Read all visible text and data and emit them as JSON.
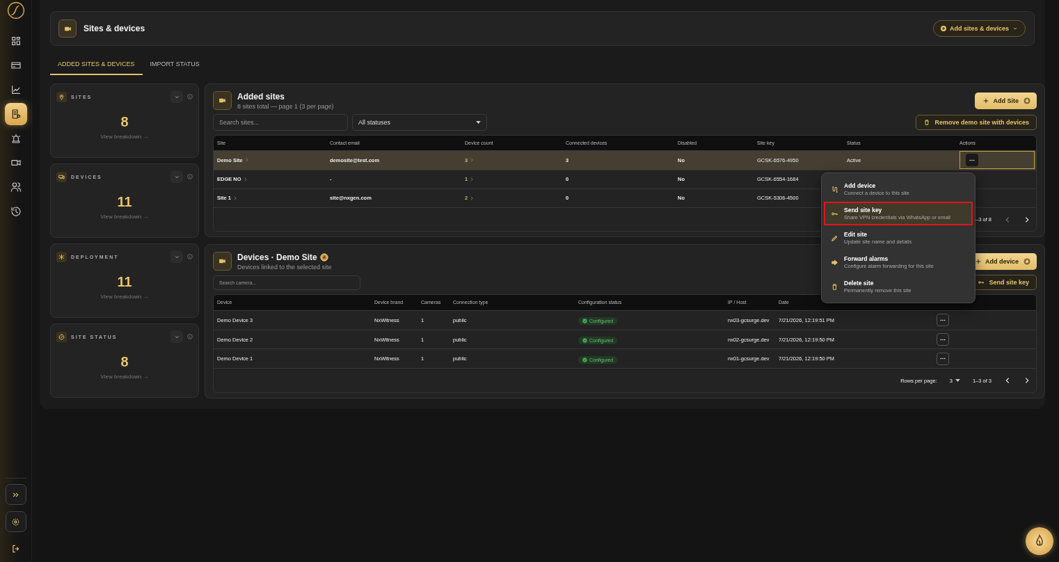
{
  "sidebar": {
    "items": [
      {
        "kind": "dashboard",
        "selected": false
      },
      {
        "kind": "billing",
        "selected": false
      },
      {
        "kind": "analytics",
        "selected": false
      },
      {
        "kind": "sites",
        "selected": true
      },
      {
        "kind": "alarms",
        "selected": false
      },
      {
        "kind": "cameras",
        "selected": false
      },
      {
        "kind": "users",
        "selected": false
      },
      {
        "kind": "history",
        "selected": false
      }
    ]
  },
  "header": {
    "title": "Sites & devices",
    "action": "Add sites & devices"
  },
  "tabs": [
    {
      "label": "ADDED SITES & DEVICES",
      "selected": true
    },
    {
      "label": "IMPORT STATUS",
      "selected": false
    }
  ],
  "stats": [
    {
      "kind": "sites",
      "label": "SITES",
      "value": "8",
      "link": "View breakdown →"
    },
    {
      "kind": "devices",
      "label": "DEVICES",
      "value": "11",
      "link": "View breakdown →"
    },
    {
      "kind": "deployment",
      "label": "DEPLOYMENT",
      "value": "11",
      "link": "View breakdown →"
    },
    {
      "kind": "status",
      "label": "SITE STATUS",
      "value": "8",
      "link": "View breakdown →"
    }
  ],
  "sites_panel": {
    "title": "Added sites",
    "subtitle": "8 sites total — page 1 (3 per page)",
    "add_button": "Add Site",
    "remove_button": "Remove demo site with devices",
    "search": {
      "placeholder": "Search sites..."
    },
    "status_filter": {
      "value": "All statuses"
    },
    "columns": [
      "Site",
      "Contact email",
      "Device count",
      "Connected devices",
      "Disabled",
      "Site key",
      "Status",
      "Actions"
    ],
    "rows": [
      {
        "site": "Demo Site",
        "email": "demosite@test.com",
        "device_count": "3",
        "connected": "3",
        "disabled": "No",
        "site_key": "GCSK-6576-4950",
        "status": "Active",
        "selected": true,
        "menu_open": true
      },
      {
        "site": "EDGE NO",
        "email": "-",
        "device_count": "1",
        "connected": "0",
        "disabled": "No",
        "site_key": "GCSK-6554-1684",
        "selected": false
      },
      {
        "site": "Site 1",
        "email": "site@nxgen.com",
        "device_count": "2",
        "connected": "0",
        "disabled": "No",
        "site_key": "GCSK-5306-4500",
        "selected": false
      }
    ],
    "pagination": "–3 of 8"
  },
  "row_menu": {
    "items": [
      {
        "kind": "add",
        "title": "Add device",
        "description": "Connect a device to this site",
        "highlighted": false
      },
      {
        "kind": "key",
        "title": "Send site key",
        "description": "Share VPN credentials via WhatsApp or email",
        "highlighted": true
      },
      {
        "kind": "edit",
        "title": "Edit site",
        "description": "Update site name and details",
        "highlighted": false
      },
      {
        "kind": "forward",
        "title": "Forward alarms",
        "description": "Configure alarm forwarding for this site",
        "highlighted": false
      },
      {
        "kind": "delete",
        "title": "Delete site",
        "description": "Permanently remove this site",
        "highlighted": false
      }
    ]
  },
  "devices_panel": {
    "title": "Devices · Demo Site",
    "subtitle": "Devices linked to the selected site",
    "add_button": "Add device",
    "key_button": "Send site key",
    "search": {
      "placeholder": "Search camera..."
    },
    "columns": [
      "Device",
      "Device brand",
      "Cameras",
      "Connection type",
      "Configuration status",
      "IP / Host",
      "Date"
    ],
    "rows": [
      {
        "device": "Demo Device 3",
        "brand": "NxWitness",
        "cameras": "1",
        "connection": "public",
        "status": "Configured",
        "host": "nx03-gcsurge.dev",
        "date": "7/21/2026, 12:19:51 PM"
      },
      {
        "device": "Demo Device 2",
        "brand": "NxWitness",
        "cameras": "1",
        "connection": "public",
        "status": "Configured",
        "host": "nx02-gcsurge.dev",
        "date": "7/21/2026, 12:19:50 PM"
      },
      {
        "device": "Demo Device 1",
        "brand": "NxWitness",
        "cameras": "1",
        "connection": "public",
        "status": "Configured",
        "host": "nx01-gcsurge.dev",
        "date": "7/21/2026, 12:19:50 PM"
      }
    ],
    "rows_per_page_label": "Rows per page:",
    "rows_per_page": "3",
    "range": "1–3 of 3"
  }
}
